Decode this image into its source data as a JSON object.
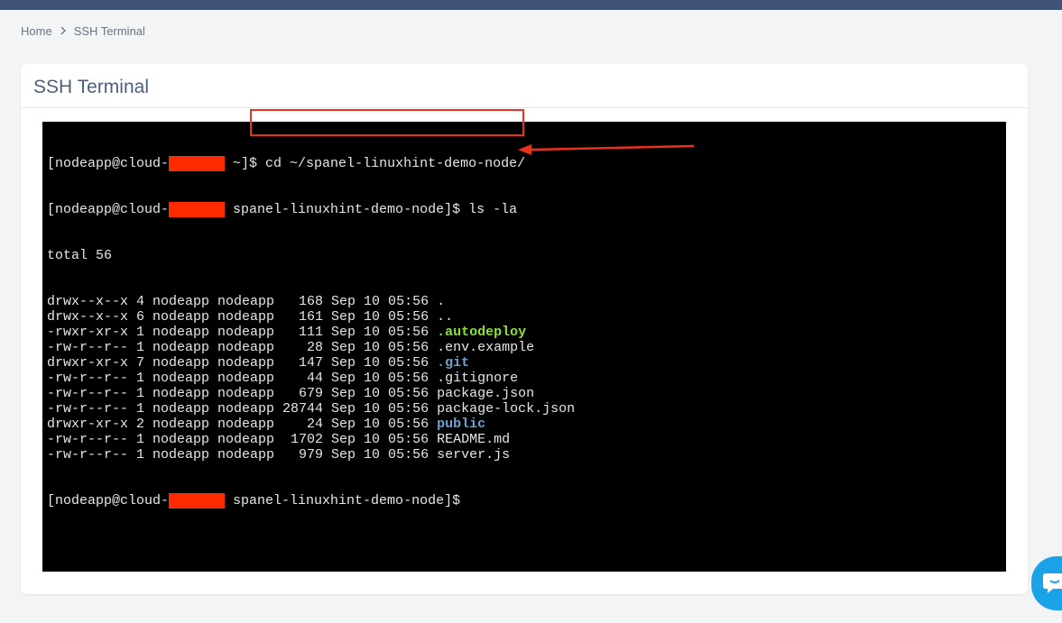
{
  "breadcrumb": {
    "home": "Home",
    "current": "SSH Terminal"
  },
  "page": {
    "title": "SSH Terminal"
  },
  "terminal": {
    "prompt1_prefix": "[nodeapp@cloud-",
    "prompt1_suffix": " ~]$ ",
    "prompt1_command": "cd ~/spanel-linuxhint-demo-node/",
    "prompt2_prefix": "[nodeapp@cloud-",
    "prompt2_suffix": " spanel-linuxhint-demo-node]$ ",
    "prompt2_command": "ls -la",
    "total": "total 56",
    "rows": [
      {
        "meta": "drwx--x--x 4 nodeapp nodeapp   168 Sep 10 05:56 ",
        "name": ".",
        "kind": "plain"
      },
      {
        "meta": "drwx--x--x 6 nodeapp nodeapp   161 Sep 10 05:56 ",
        "name": "..",
        "kind": "plain"
      },
      {
        "meta": "-rwxr-xr-x 1 nodeapp nodeapp   111 Sep 10 05:56 ",
        "name": ".autodeploy",
        "kind": "exec"
      },
      {
        "meta": "-rw-r--r-- 1 nodeapp nodeapp    28 Sep 10 05:56 ",
        "name": ".env.example",
        "kind": "plain"
      },
      {
        "meta": "drwxr-xr-x 7 nodeapp nodeapp   147 Sep 10 05:56 ",
        "name": ".git",
        "kind": "dir"
      },
      {
        "meta": "-rw-r--r-- 1 nodeapp nodeapp    44 Sep 10 05:56 ",
        "name": ".gitignore",
        "kind": "plain"
      },
      {
        "meta": "-rw-r--r-- 1 nodeapp nodeapp   679 Sep 10 05:56 ",
        "name": "package.json",
        "kind": "plain"
      },
      {
        "meta": "-rw-r--r-- 1 nodeapp nodeapp 28744 Sep 10 05:56 ",
        "name": "package-lock.json",
        "kind": "plain"
      },
      {
        "meta": "drwxr-xr-x 2 nodeapp nodeapp    24 Sep 10 05:56 ",
        "name": "public",
        "kind": "dir"
      },
      {
        "meta": "-rw-r--r-- 1 nodeapp nodeapp  1702 Sep 10 05:56 ",
        "name": "README.md",
        "kind": "plain"
      },
      {
        "meta": "-rw-r--r-- 1 nodeapp nodeapp   979 Sep 10 05:56 ",
        "name": "server.js",
        "kind": "plain"
      }
    ],
    "prompt3_prefix": "[nodeapp@cloud-",
    "prompt3_suffix": " spanel-linuxhint-demo-node]$"
  },
  "colors": {
    "topbar": "#3f5378",
    "terminal_bg": "#000000",
    "terminal_fg": "#e6e6e6",
    "exec_file": "#8ae234",
    "directory": "#729fcf",
    "redaction": "#ff2a00",
    "annotation": "#e8321e",
    "chat_button": "#1aa3e8"
  },
  "icons": {
    "breadcrumb_separator": "chevron-right-icon",
    "chat": "chat-bubble-icon"
  }
}
